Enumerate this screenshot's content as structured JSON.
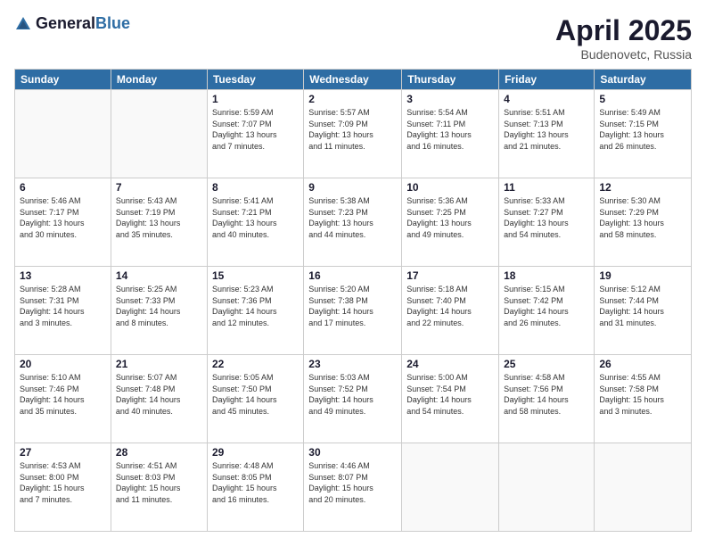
{
  "header": {
    "logo_general": "General",
    "logo_blue": "Blue",
    "month_title": "April 2025",
    "location": "Budenovetc, Russia"
  },
  "days_of_week": [
    "Sunday",
    "Monday",
    "Tuesday",
    "Wednesday",
    "Thursday",
    "Friday",
    "Saturday"
  ],
  "weeks": [
    [
      {
        "day": "",
        "info": ""
      },
      {
        "day": "",
        "info": ""
      },
      {
        "day": "1",
        "info": "Sunrise: 5:59 AM\nSunset: 7:07 PM\nDaylight: 13 hours\nand 7 minutes."
      },
      {
        "day": "2",
        "info": "Sunrise: 5:57 AM\nSunset: 7:09 PM\nDaylight: 13 hours\nand 11 minutes."
      },
      {
        "day": "3",
        "info": "Sunrise: 5:54 AM\nSunset: 7:11 PM\nDaylight: 13 hours\nand 16 minutes."
      },
      {
        "day": "4",
        "info": "Sunrise: 5:51 AM\nSunset: 7:13 PM\nDaylight: 13 hours\nand 21 minutes."
      },
      {
        "day": "5",
        "info": "Sunrise: 5:49 AM\nSunset: 7:15 PM\nDaylight: 13 hours\nand 26 minutes."
      }
    ],
    [
      {
        "day": "6",
        "info": "Sunrise: 5:46 AM\nSunset: 7:17 PM\nDaylight: 13 hours\nand 30 minutes."
      },
      {
        "day": "7",
        "info": "Sunrise: 5:43 AM\nSunset: 7:19 PM\nDaylight: 13 hours\nand 35 minutes."
      },
      {
        "day": "8",
        "info": "Sunrise: 5:41 AM\nSunset: 7:21 PM\nDaylight: 13 hours\nand 40 minutes."
      },
      {
        "day": "9",
        "info": "Sunrise: 5:38 AM\nSunset: 7:23 PM\nDaylight: 13 hours\nand 44 minutes."
      },
      {
        "day": "10",
        "info": "Sunrise: 5:36 AM\nSunset: 7:25 PM\nDaylight: 13 hours\nand 49 minutes."
      },
      {
        "day": "11",
        "info": "Sunrise: 5:33 AM\nSunset: 7:27 PM\nDaylight: 13 hours\nand 54 minutes."
      },
      {
        "day": "12",
        "info": "Sunrise: 5:30 AM\nSunset: 7:29 PM\nDaylight: 13 hours\nand 58 minutes."
      }
    ],
    [
      {
        "day": "13",
        "info": "Sunrise: 5:28 AM\nSunset: 7:31 PM\nDaylight: 14 hours\nand 3 minutes."
      },
      {
        "day": "14",
        "info": "Sunrise: 5:25 AM\nSunset: 7:33 PM\nDaylight: 14 hours\nand 8 minutes."
      },
      {
        "day": "15",
        "info": "Sunrise: 5:23 AM\nSunset: 7:36 PM\nDaylight: 14 hours\nand 12 minutes."
      },
      {
        "day": "16",
        "info": "Sunrise: 5:20 AM\nSunset: 7:38 PM\nDaylight: 14 hours\nand 17 minutes."
      },
      {
        "day": "17",
        "info": "Sunrise: 5:18 AM\nSunset: 7:40 PM\nDaylight: 14 hours\nand 22 minutes."
      },
      {
        "day": "18",
        "info": "Sunrise: 5:15 AM\nSunset: 7:42 PM\nDaylight: 14 hours\nand 26 minutes."
      },
      {
        "day": "19",
        "info": "Sunrise: 5:12 AM\nSunset: 7:44 PM\nDaylight: 14 hours\nand 31 minutes."
      }
    ],
    [
      {
        "day": "20",
        "info": "Sunrise: 5:10 AM\nSunset: 7:46 PM\nDaylight: 14 hours\nand 35 minutes."
      },
      {
        "day": "21",
        "info": "Sunrise: 5:07 AM\nSunset: 7:48 PM\nDaylight: 14 hours\nand 40 minutes."
      },
      {
        "day": "22",
        "info": "Sunrise: 5:05 AM\nSunset: 7:50 PM\nDaylight: 14 hours\nand 45 minutes."
      },
      {
        "day": "23",
        "info": "Sunrise: 5:03 AM\nSunset: 7:52 PM\nDaylight: 14 hours\nand 49 minutes."
      },
      {
        "day": "24",
        "info": "Sunrise: 5:00 AM\nSunset: 7:54 PM\nDaylight: 14 hours\nand 54 minutes."
      },
      {
        "day": "25",
        "info": "Sunrise: 4:58 AM\nSunset: 7:56 PM\nDaylight: 14 hours\nand 58 minutes."
      },
      {
        "day": "26",
        "info": "Sunrise: 4:55 AM\nSunset: 7:58 PM\nDaylight: 15 hours\nand 3 minutes."
      }
    ],
    [
      {
        "day": "27",
        "info": "Sunrise: 4:53 AM\nSunset: 8:00 PM\nDaylight: 15 hours\nand 7 minutes."
      },
      {
        "day": "28",
        "info": "Sunrise: 4:51 AM\nSunset: 8:03 PM\nDaylight: 15 hours\nand 11 minutes."
      },
      {
        "day": "29",
        "info": "Sunrise: 4:48 AM\nSunset: 8:05 PM\nDaylight: 15 hours\nand 16 minutes."
      },
      {
        "day": "30",
        "info": "Sunrise: 4:46 AM\nSunset: 8:07 PM\nDaylight: 15 hours\nand 20 minutes."
      },
      {
        "day": "",
        "info": ""
      },
      {
        "day": "",
        "info": ""
      },
      {
        "day": "",
        "info": ""
      }
    ]
  ]
}
